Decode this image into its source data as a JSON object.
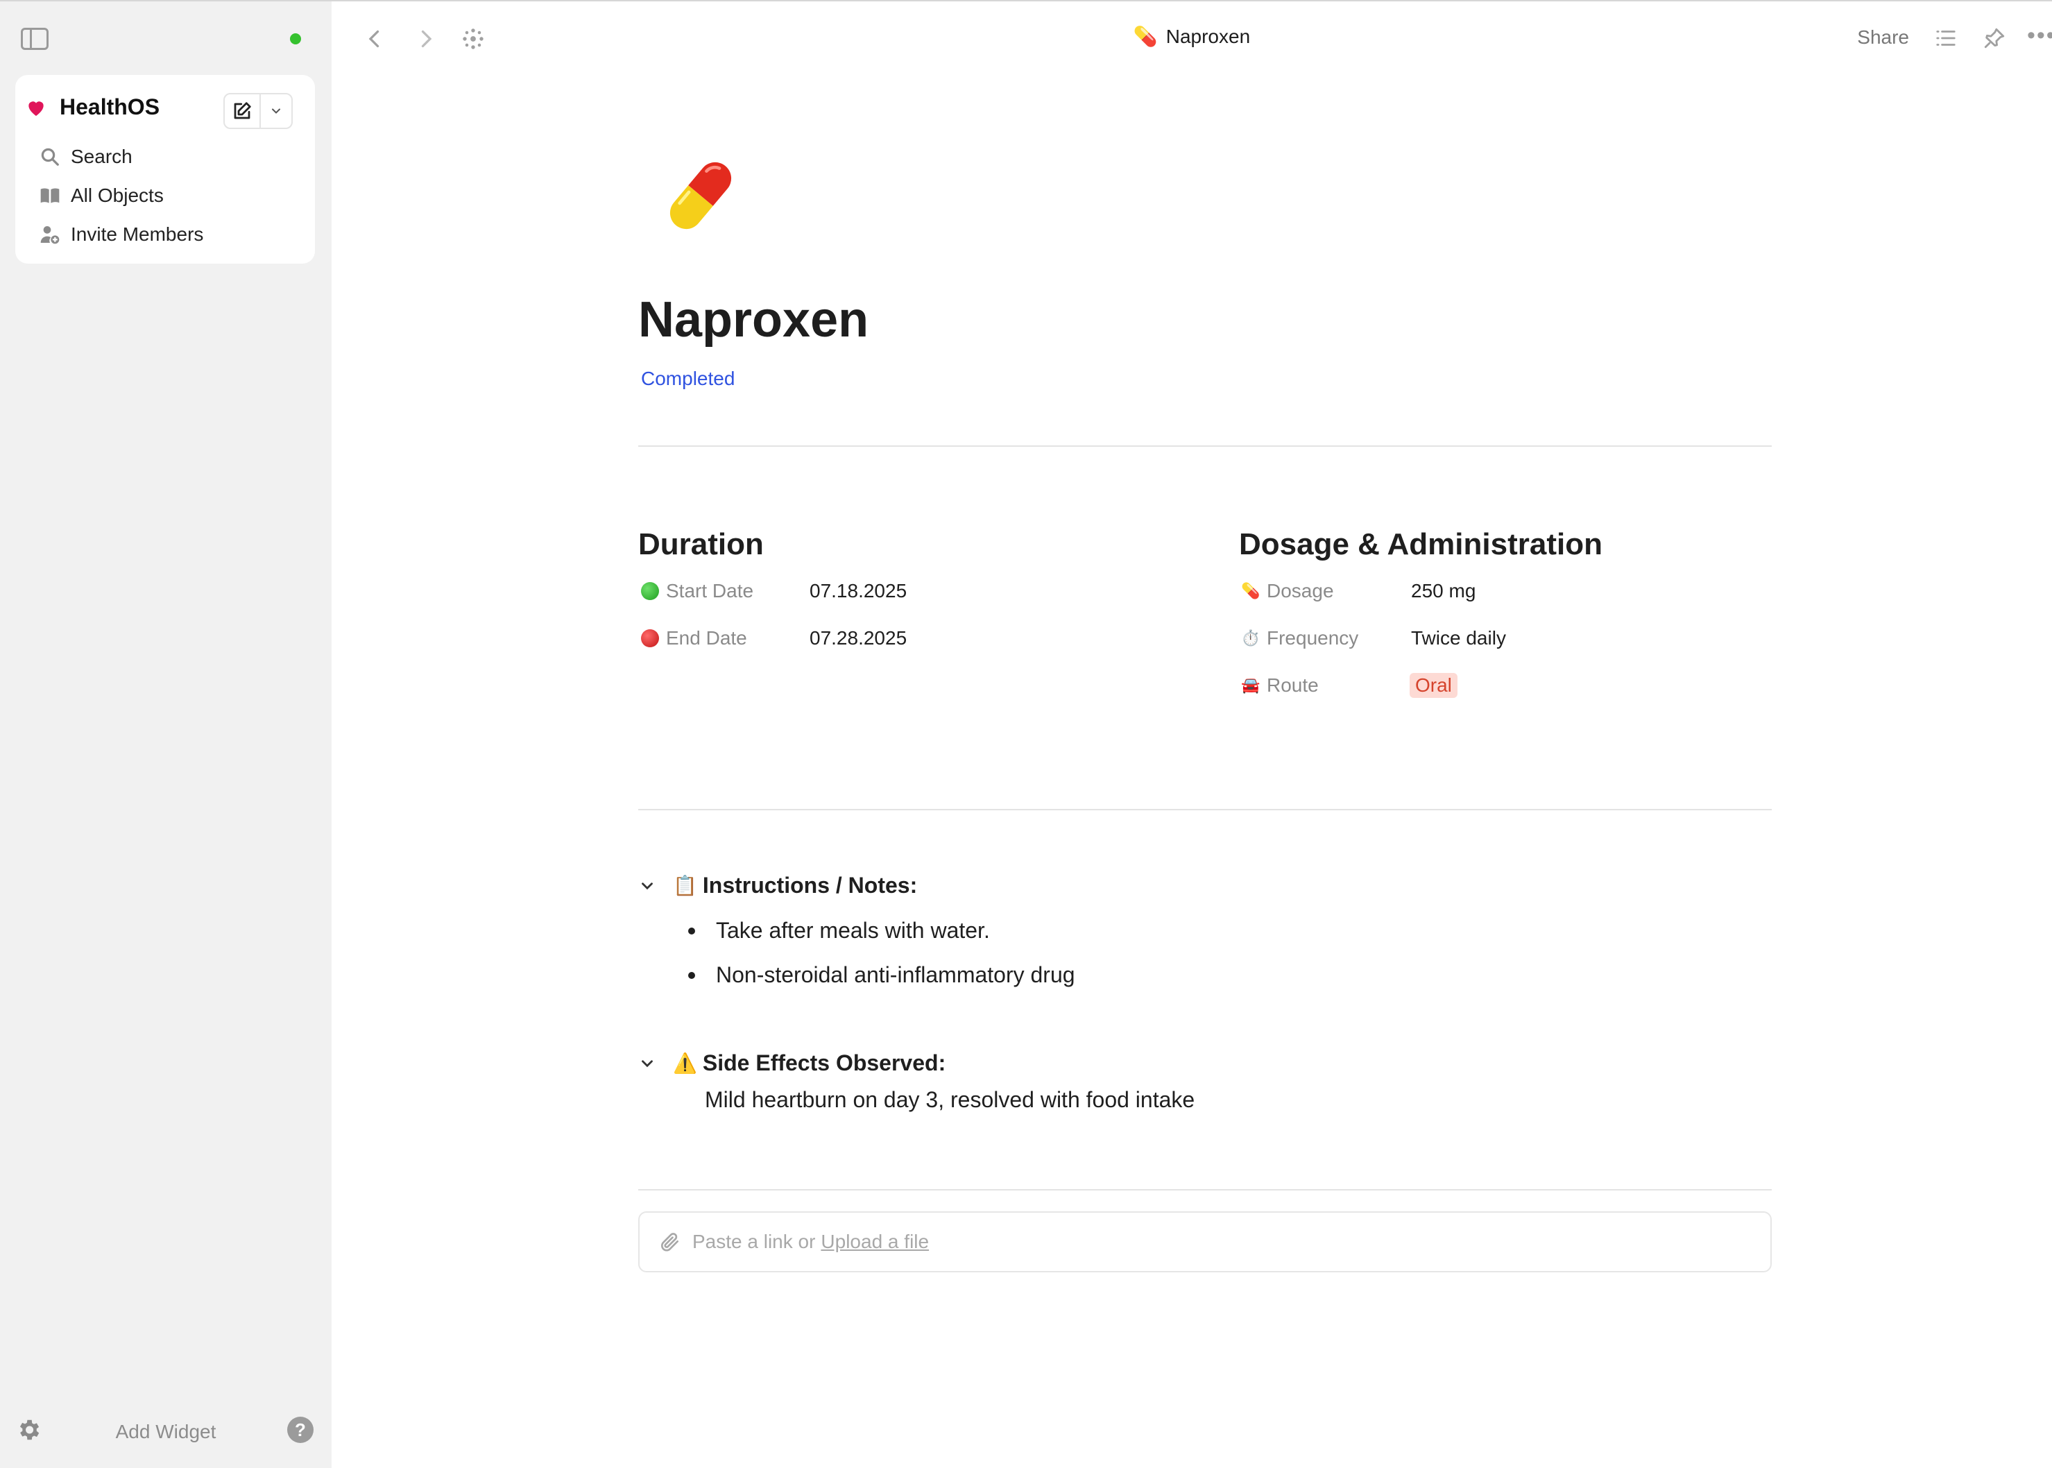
{
  "sidebar": {
    "space_name": "HealthOS",
    "nav": [
      {
        "label": "Search",
        "icon": "search-icon"
      },
      {
        "label": "All Objects",
        "icon": "book-icon"
      },
      {
        "label": "Invite Members",
        "icon": "add-member-icon"
      }
    ],
    "footer": {
      "add_widget": "Add Widget",
      "help": "?"
    }
  },
  "topbar": {
    "title": "Naproxen",
    "title_emoji": "💊",
    "share": "Share"
  },
  "document": {
    "title": "Naproxen",
    "status": "Completed",
    "status_color": "#2f52e0",
    "duration": {
      "heading": "Duration",
      "start_label": "Start Date",
      "start_value": "07.18.2025",
      "end_label": "End Date",
      "end_value": "07.28.2025"
    },
    "dosage": {
      "heading": "Dosage & Administration",
      "dosage_label": "Dosage",
      "dosage_emoji": "💊",
      "dosage_value": "250 mg",
      "frequency_label": "Frequency",
      "frequency_emoji": "⏱️",
      "frequency_value": "Twice daily",
      "route_label": "Route",
      "route_emoji": "🚘",
      "route_value": "Oral"
    },
    "instructions": {
      "emoji": "📋",
      "heading": "Instructions / Notes:",
      "items": [
        "Take after meals with water.",
        "Non-steroidal anti-inflammatory drug"
      ]
    },
    "side_effects": {
      "emoji": "⚠️",
      "heading": "Side Effects Observed:",
      "text": "Mild heartburn on day 3, resolved with food intake"
    },
    "attach": {
      "prefix": "Paste a link or",
      "upload": "Upload a file"
    }
  },
  "colors": {
    "accent_blue": "#2f52e0",
    "heart": "#e0155a",
    "online": "#35c12e",
    "oral_tag_bg": "#fddad4",
    "oral_tag_text": "#d5432c"
  }
}
